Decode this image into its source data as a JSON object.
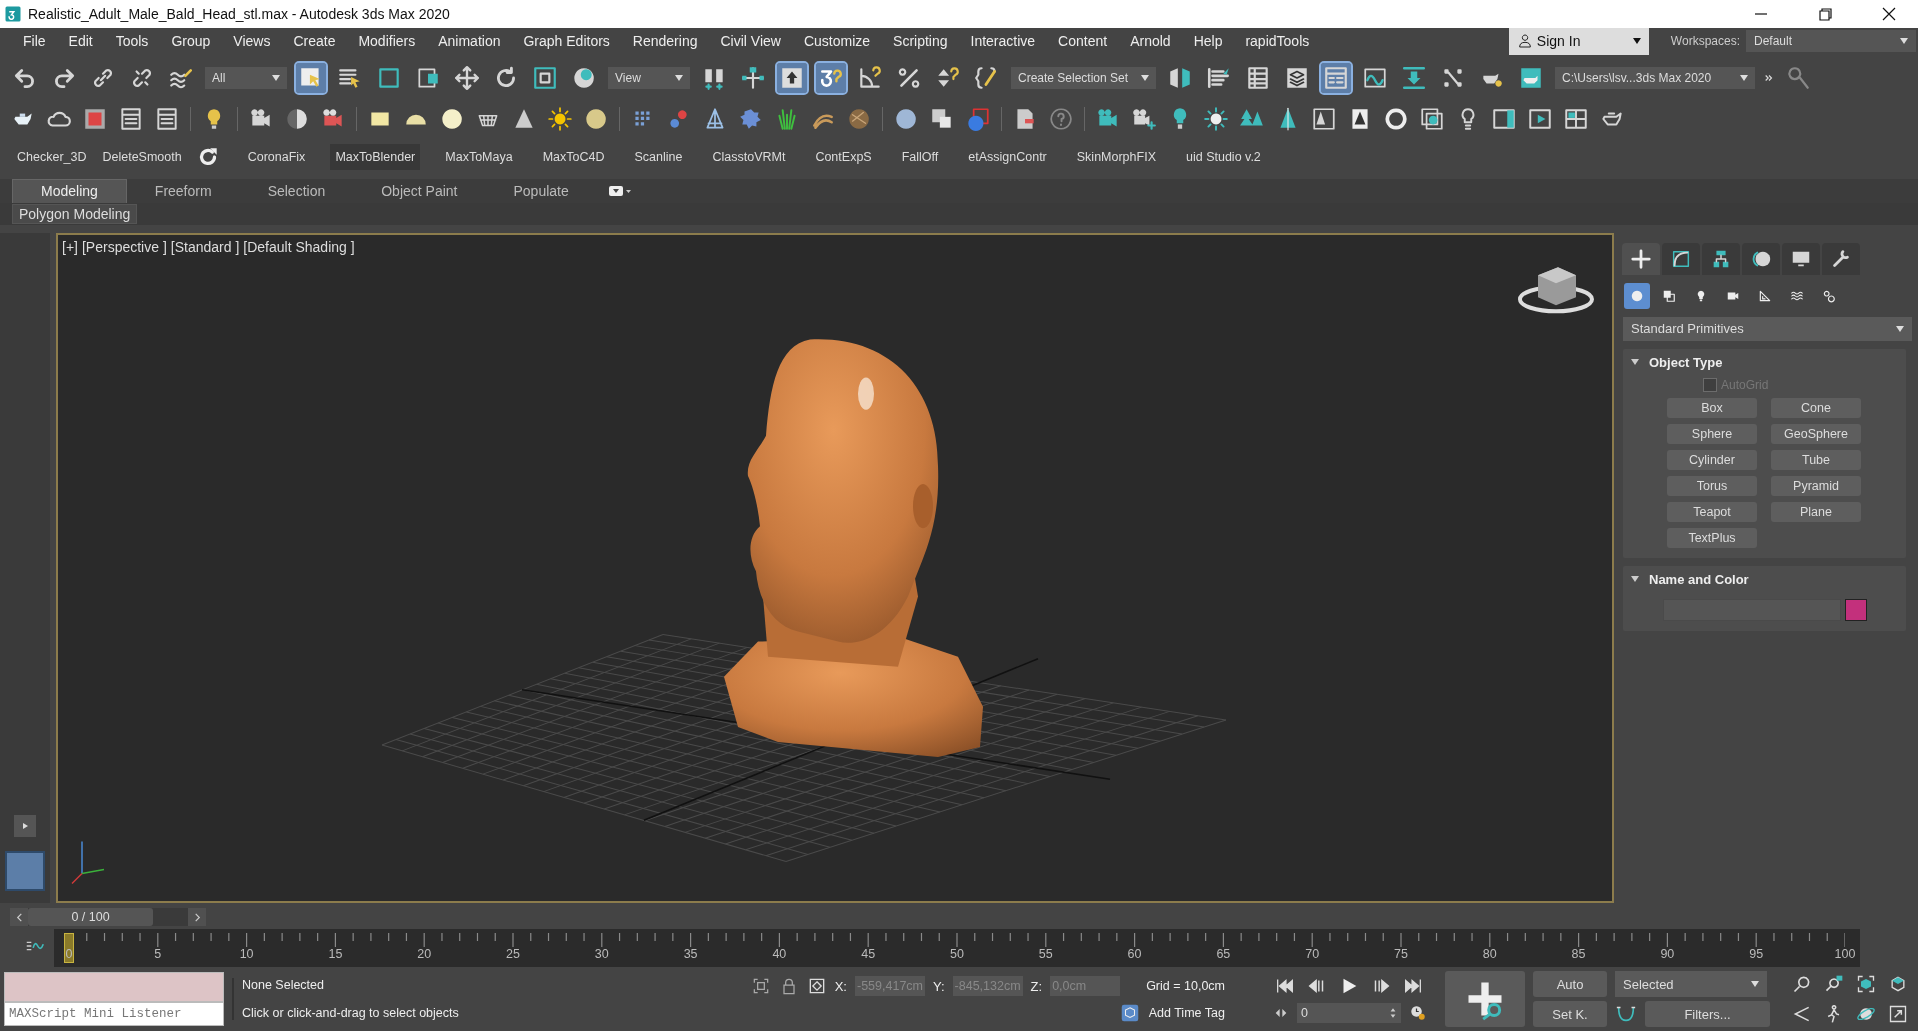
{
  "window": {
    "title": "Realistic_Adult_Male_Bald_Head_stl.max - Autodesk 3ds Max 2020"
  },
  "menu_bar": {
    "items": [
      "File",
      "Edit",
      "Tools",
      "Group",
      "Views",
      "Create",
      "Modifiers",
      "Animation",
      "Graph Editors",
      "Rendering",
      "Civil View",
      "Customize",
      "Scripting",
      "Interactive",
      "Content",
      "Arnold",
      "Help",
      "rapidTools"
    ],
    "sign_in": "Sign In",
    "workspaces_label": "Workspaces:",
    "workspace": "Default"
  },
  "main_toolbar": [
    {
      "kind": "icon",
      "selected": false
    },
    {
      "kind": "icon",
      "selected": false
    },
    {
      "kind": "icon",
      "selected": false
    },
    {
      "kind": "icon",
      "selected": false
    },
    {
      "kind": "icon",
      "selected": false
    },
    {
      "kind": "dropdown",
      "value": "All"
    },
    {
      "kind": "icon",
      "selected": true
    },
    {
      "kind": "icon",
      "selected": false
    },
    {
      "kind": "icon",
      "selected": false
    },
    {
      "kind": "icon",
      "selected": false
    },
    {
      "kind": "icon",
      "selected": false
    },
    {
      "kind": "icon",
      "selected": false
    },
    {
      "kind": "icon",
      "selected": false
    },
    {
      "kind": "icon",
      "selected": false
    },
    {
      "kind": "dropdown",
      "value": "View"
    },
    {
      "kind": "icon",
      "selected": false
    },
    {
      "kind": "icon",
      "selected": false
    },
    {
      "kind": "icon",
      "selected": true
    },
    {
      "kind": "icon",
      "selected": true
    },
    {
      "kind": "icon",
      "selected": false
    },
    {
      "kind": "icon",
      "selected": false
    },
    {
      "kind": "icon",
      "selected": false
    },
    {
      "kind": "icon",
      "selected": false
    },
    {
      "kind": "dropdown",
      "value": "Create Selection Set"
    },
    {
      "kind": "icon",
      "selected": false
    },
    {
      "kind": "icon",
      "selected": false
    },
    {
      "kind": "icon",
      "selected": false
    },
    {
      "kind": "icon",
      "selected": false
    },
    {
      "kind": "icon",
      "selected": true
    },
    {
      "kind": "icon",
      "selected": false
    },
    {
      "kind": "icon",
      "selected": false
    },
    {
      "kind": "icon",
      "selected": false
    },
    {
      "kind": "icon",
      "selected": false
    },
    {
      "kind": "icon",
      "selected": false
    },
    {
      "kind": "dropdown",
      "value": "C:\\Users\\lsv...3ds Max 2020"
    }
  ],
  "script_toolbar": [
    {
      "kind": "label",
      "text": "Checker_3D",
      "selected": false
    },
    {
      "kind": "label",
      "text": "DeleteSmooth",
      "selected": false
    },
    {
      "kind": "icon"
    },
    {
      "kind": "label",
      "text": "CoronaFix",
      "selected": false
    },
    {
      "kind": "label",
      "text": "MaxToBlender",
      "selected": true
    },
    {
      "kind": "label",
      "text": "MaxToMaya",
      "selected": false
    },
    {
      "kind": "label",
      "text": "MaxToC4D",
      "selected": false
    },
    {
      "kind": "label",
      "text": "Scanline",
      "selected": false
    },
    {
      "kind": "label",
      "text": "ClasstoVRMt",
      "selected": false
    },
    {
      "kind": "label",
      "text": "ContExpS",
      "selected": false
    },
    {
      "kind": "label",
      "text": "FallOff",
      "selected": false
    },
    {
      "kind": "label",
      "text": "etAssignContr",
      "selected": false
    },
    {
      "kind": "label",
      "text": "SkinMorphFIX",
      "selected": false
    },
    {
      "kind": "label",
      "text": "uid Studio v.2",
      "selected": false
    }
  ],
  "ribbon": {
    "tabs": [
      {
        "label": "Modeling",
        "selected": true
      },
      {
        "label": "Freeform",
        "selected": false
      },
      {
        "label": "Selection",
        "selected": false
      },
      {
        "label": "Object Paint",
        "selected": false
      },
      {
        "label": "Populate",
        "selected": false
      }
    ],
    "panel": "Polygon Modeling"
  },
  "viewport": {
    "labels": [
      "[+]",
      "[Perspective ]",
      "[Standard ]",
      "[Default Shading ]"
    ]
  },
  "command_panel": {
    "tabs": [
      {
        "selected": true
      },
      {
        "selected": false
      },
      {
        "selected": false
      },
      {
        "selected": false
      },
      {
        "selected": false
      },
      {
        "selected": false
      }
    ],
    "categories": [
      {
        "selected": true
      },
      {
        "selected": false
      },
      {
        "selected": false
      },
      {
        "selected": false
      },
      {
        "selected": false
      },
      {
        "selected": false
      },
      {
        "selected": false
      }
    ],
    "dropdown": "Standard Primitives",
    "object_type": {
      "title": "Object Type",
      "expanded": true,
      "autogrid": {
        "label": "AutoGrid",
        "checked": false,
        "disabled": true
      },
      "buttons": [
        "Box",
        "Cone",
        "Sphere",
        "GeoSphere",
        "Cylinder",
        "Tube",
        "Torus",
        "Pyramid",
        "Teapot",
        "Plane",
        "TextPlus"
      ]
    },
    "name_and_color": {
      "title": "Name and Color",
      "expanded": true,
      "color": "#c3307c"
    }
  },
  "timeline": {
    "frame": "0 / 100",
    "level": 0,
    "ticks": [
      "0",
      "5",
      "10",
      "15",
      "20",
      "25",
      "30",
      "35",
      "40",
      "45",
      "50",
      "55",
      "60",
      "65",
      "70",
      "75",
      "80",
      "85",
      "90",
      "95",
      "100"
    ]
  },
  "status": {
    "listener": "MAXScript Mini Listener",
    "selection": "None Selected",
    "prompt": "Click or click-and-drag to select objects",
    "x_label": "X:",
    "x": "-559,417cm",
    "y_label": "Y:",
    "y": "-845,132cm",
    "z_label": "Z:",
    "z": "0,0cm",
    "grid": "Grid = 10,0cm",
    "add_time_tag": "Add Time Tag",
    "frame": "0",
    "auto": "Auto",
    "set_key": "Set K.",
    "key_filter": "Selected",
    "filters": "Filters..."
  }
}
